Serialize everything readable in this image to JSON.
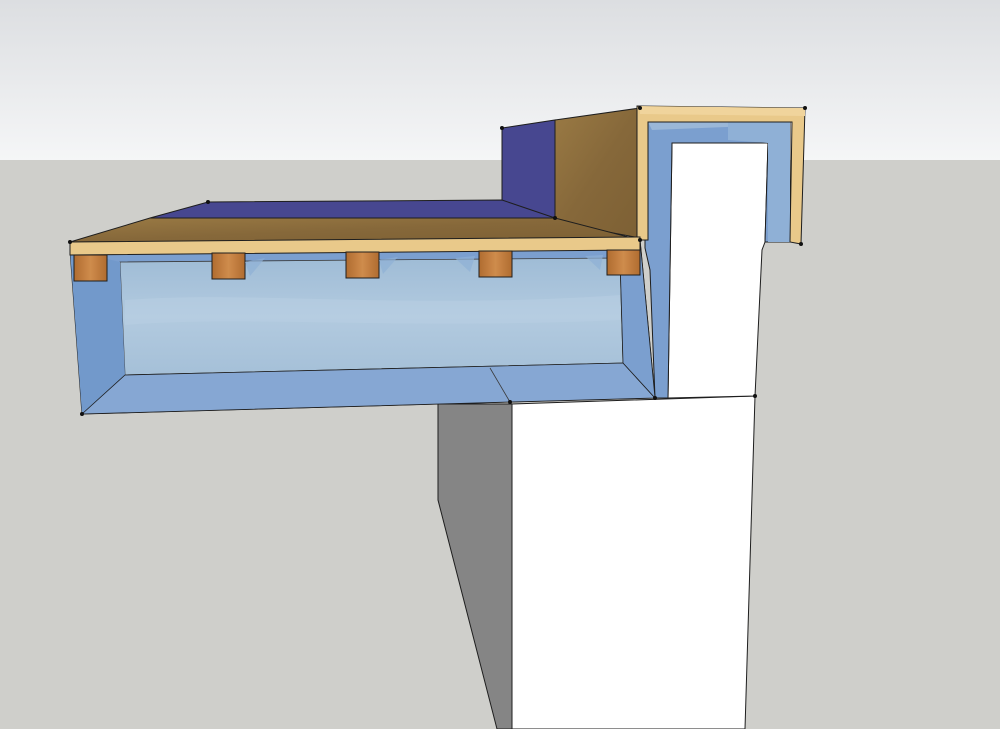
{
  "scene": {
    "type": "3D section model of a flat roof edge with parapet",
    "text": [],
    "colors": {
      "sky_top": "#dfe1e3",
      "sky_bottom": "#f4f5f6",
      "ground": "#cfcfcb",
      "wall_front": "#ffffff",
      "wall_shadow": "#858585",
      "membrane": "#474790",
      "osb": "#8a6d3a",
      "osb_edge": "#e9c98a",
      "insulation_blue": "#7b9fcf",
      "insulation_inner": "#a9c4dd",
      "joist": "#c07a3a",
      "edge_lines": "#1e1e1e"
    }
  }
}
